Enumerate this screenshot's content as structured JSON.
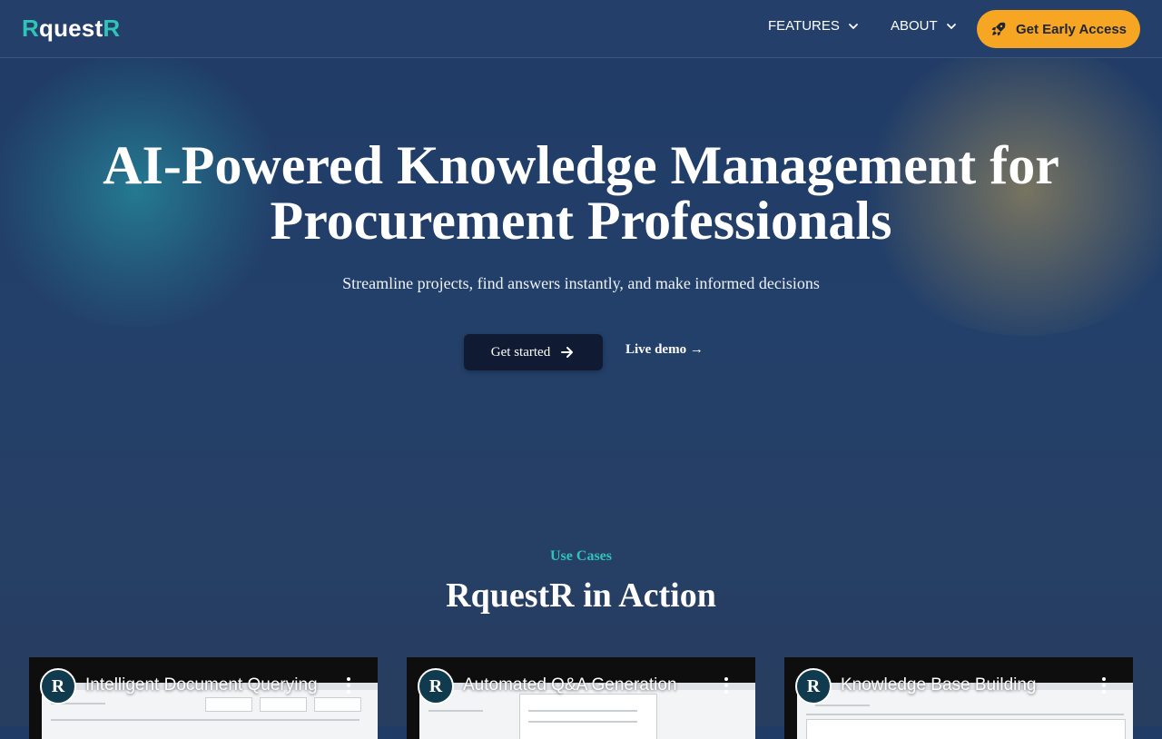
{
  "header": {
    "logo": {
      "first": "R",
      "middle": "quest",
      "last": "R"
    },
    "nav": [
      {
        "label": "FEATURES",
        "icon": "chevron-down-icon"
      },
      {
        "label": "ABOUT",
        "icon": "chevron-down-icon"
      }
    ],
    "cta": {
      "label": "Get Early Access",
      "icon": "rocket-icon"
    }
  },
  "hero": {
    "title_line1": "AI-Powered Knowledge Management for",
    "title_line2": "Procurement Professionals",
    "subtitle": "Streamline projects, find answers instantly, and make informed decisions",
    "primary_button": "Get started",
    "secondary_button": "Live demo →"
  },
  "use_cases": {
    "label": "Use Cases",
    "title": "RquestR in Action",
    "videos": [
      {
        "title": "Intelligent Document Querying",
        "avatar_letter": "R"
      },
      {
        "title": "Automated Q&A Generation",
        "avatar_letter": "R"
      },
      {
        "title": "Knowledge Base Building",
        "avatar_letter": "R"
      }
    ]
  },
  "colors": {
    "accent_teal": "#2fc4b7",
    "cta_orange": "#f6a623",
    "background": "#23406a"
  }
}
